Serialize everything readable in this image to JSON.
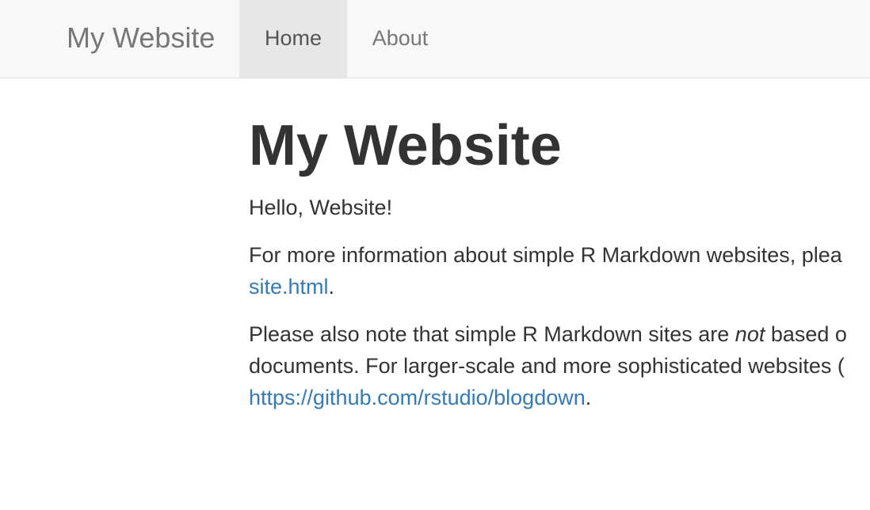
{
  "navbar": {
    "brand": "My Website",
    "items": [
      {
        "label": "Home",
        "active": true
      },
      {
        "label": "About",
        "active": false
      }
    ]
  },
  "main": {
    "title": "My Website",
    "greeting": "Hello, Website!",
    "para1_line1": "For more information about simple R Markdown websites, plea",
    "para1_link": "site.html",
    "para1_end": ".",
    "para2_line1_start": "Please also note that simple R Markdown sites are ",
    "para2_emphasis": "not",
    "para2_line1_end": " based o",
    "para2_line2": "documents. For larger-scale and more sophisticated websites (",
    "para2_link": "https://github.com/rstudio/blogdown",
    "para2_end": "."
  },
  "colors": {
    "navbar_bg": "#f8f8f8",
    "active_tab_bg": "#e7e7e7",
    "link": "#337ab7",
    "text": "#333333"
  }
}
